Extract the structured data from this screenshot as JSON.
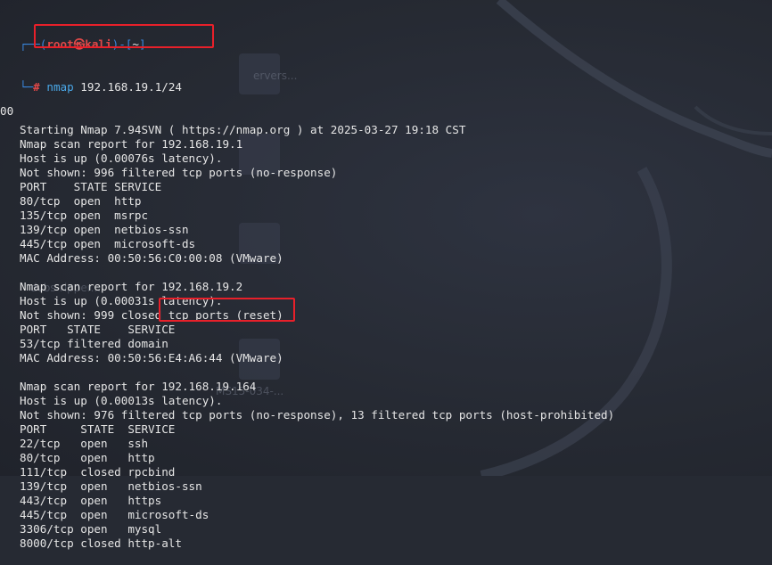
{
  "desktop": {
    "labels": [
      "ervers...",
      "dvbs-ripper...",
      "MS15-034-..."
    ]
  },
  "prompt": {
    "frame_top": "┌──(",
    "user": "root㉿kali",
    "frame_mid": ")-[",
    "dir": "~",
    "frame_end": "]",
    "frame_bottom": "└─",
    "hash": "#",
    "cmd_word": "nmap",
    "cmd_args": " 192.168.19.1/24"
  },
  "output": [
    "Starting Nmap 7.94SVN ( https://nmap.org ) at 2025-03-27 19:18 CST",
    "Nmap scan report for 192.168.19.1",
    "Host is up (0.00076s latency).",
    "Not shown: 996 filtered tcp ports (no-response)",
    "PORT    STATE SERVICE",
    "80/tcp  open  http",
    "135/tcp open  msrpc",
    "139/tcp open  netbios-ssn",
    "445/tcp open  microsoft-ds",
    "MAC Address: 00:50:56:C0:00:08 (VMware)",
    "",
    "Nmap scan report for 192.168.19.2",
    "Host is up (0.00031s latency).",
    "Not shown: 999 closed tcp ports (reset)",
    "PORT   STATE    SERVICE",
    "53/tcp filtered domain",
    "MAC Address: 00:50:56:E4:A6:44 (VMware)",
    "",
    "Nmap scan report for 192.168.19.164",
    "Host is up (0.00013s latency).",
    "Not shown: 976 filtered tcp ports (no-response), 13 filtered tcp ports (host-prohibited)",
    "PORT     STATE  SERVICE",
    "22/tcp   open   ssh",
    "80/tcp   open   http",
    "111/tcp  closed rpcbind",
    "139/tcp  open   netbios-ssn",
    "443/tcp  open   https",
    "445/tcp  open   microsoft-ds",
    "3306/tcp open   mysql",
    "8000/tcp closed http-alt"
  ],
  "edge_fragment": "00",
  "colors": {
    "highlight": "#e8202a",
    "prompt_user": "#e04848",
    "prompt_frame": "#3a88e0",
    "background": "#262a33"
  }
}
